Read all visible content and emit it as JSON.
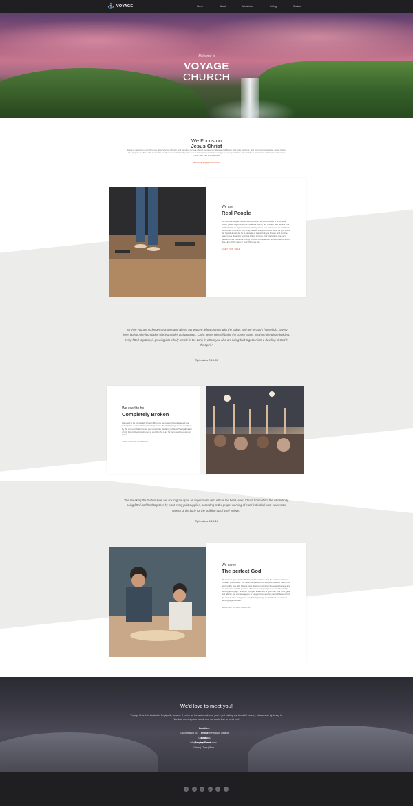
{
  "nav": {
    "logo": "VOYAGE",
    "links": [
      "Home",
      "About",
      "Ministries",
      "Giving",
      "Contact"
    ]
  },
  "hero": {
    "welcome": "Welcome to",
    "title": "VOYAGE",
    "subtitle": "CHURCH"
  },
  "focus": {
    "title_line1": "We Focus on",
    "title_line2": "Jesus Christ",
    "body": "Jesus is central to everything we do at Voyage Church and we strive to be a church focused on His powerful Name. Our joint, persons, and forum is centered on Jesus Christ. Our purpose on this earth is to make much of Jesus Christ. If you're new to Voyage we would love to get to know you better. If you'd like to know more information about our church feel free to email us at",
    "email": "welcome@voyagechurch.com"
  },
  "section1": {
    "label": "We are",
    "heading": "Real People",
    "body": "We are real people infused with dynamic faith, committed to a common vision, joined together in the covenant love of our Creator. We believe in a multicultural, multigenerational ministry who's sole intention is to reach our community for Christ. We firmly believe that you should come as you are to the feet of Jesus, for he is capable of transforming a broken and contrite heart into a blooming soul that brings Him joy. Our gatherings are very casual but we make it a priority to focus our attention on God's Word and to give Him all the glory in everything we do.",
    "link": "MEET OUR TEAM"
  },
  "quote1": {
    "text": "\"So then you are no longer strangers and aliens, but you are fellow citizens with the saints, and are of God's household, having been built on the foundation of the apostles and prophets, Christ Jesus Himself being the corner stone, in whom the whole building, being fitted together, is growing into a holy temple in the Lord, in whom you also are being built together into a dwelling of God in the Spirit.\"",
    "ref": "Ephesians 2:19-22"
  },
  "section2": {
    "label": "We used to be",
    "heading": "Completely Broken",
    "body": "We used to be completely broken. But now we powerful be redeemed and redemption, surrounded by amazing Grace, healed by forgiveness, humbled by the divine invitation to be welcomed into the family of God. The realization of this faith is lifted inspires us to worship the Lord for he is worthy of all our praise.",
    "link": "JOIN US FOR WORSHIP"
  },
  "quote2": {
    "text": "\"but speaking the truth in love, we are to grow up in all aspects into Him who is the head, even Christ, from whom the whole body, being fitted and held together by what every joint supplies, according to the proper working of each individual part, causes the growth of the body for the building up of itself in love.\"",
    "ref": "Ephesians 4:15-16"
  },
  "section3": {
    "label": "We serve",
    "heading": "The perfect God",
    "body": "We serve a good and perfect God. The widows are His dwelling and our lives are His vessels. We have compassion for the poor, and our hearts are open to the sick. We believe God desires to prosper those who believe and are generous for His purpose. There are many ways to get involved with serving at Voyage. Whether you give financially or give with your time, gifts and talents, we encourage you to be generous and let yourself be a part of the work God is doing. Visit our \"Ministry\" page to check out our current serving opportunities.",
    "link": "SERVING OPPORTUNITIES"
  },
  "meet": {
    "title": "We'd love to meet you!",
    "body": "Voyage Church is located in Reykjavik, Iceland. If you're an Icelandic native or you're just visiting our beautiful country, please stop by to say hi. We love meeting new people and we would love to meet you!",
    "location_label": "Location:",
    "address_left": "238 Vatnsholt St",
    "address_right": "Reykjavik, Iceland",
    "phone_label": "Phone:",
    "phone": "238-233-433",
    "email_label": "Email:",
    "email": "info@voyagechurch.com",
    "service_label": "Service Times:",
    "service_times": "10am | 12pm | 5pm"
  },
  "footer": {
    "social": [
      "facebook-icon",
      "twitter-icon",
      "instagram-icon",
      "pinterest-icon",
      "telegram-icon",
      "vimeo-icon"
    ],
    "social_glyphs": [
      "f",
      "t",
      "◎",
      "p",
      "➤",
      "v"
    ]
  },
  "colors": {
    "accent": "#e0582a",
    "nav_bg": "#1f1f22"
  }
}
